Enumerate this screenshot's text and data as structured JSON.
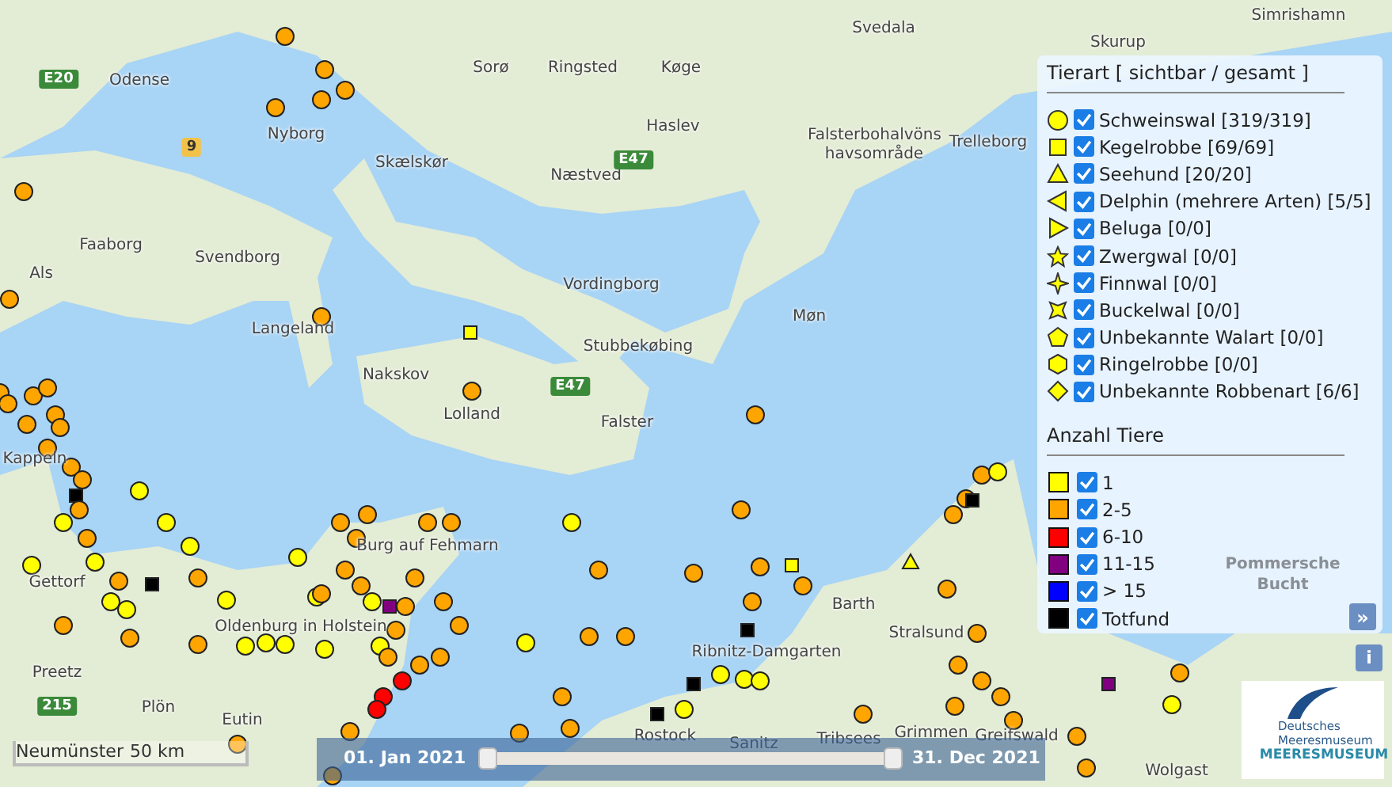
{
  "map": {
    "places": [
      "Svedala",
      "Simrishamn",
      "Odense",
      "Sorø",
      "Ringsted",
      "Køge",
      "Skurup",
      "Trelleborg",
      "Falsterbohalvöns havsområde",
      "Haslev",
      "Nyborg",
      "Skælskør",
      "Næstved",
      "Faaborg",
      "Svendborg",
      "Als",
      "Vordingborg",
      "Langeland",
      "Møn",
      "Stubbekøbing",
      "Nakskov",
      "Lolland",
      "Falster",
      "Kappeln",
      "Gettorf",
      "Burg auf Fehmarn",
      "Oldenburg in Holstein",
      "Preetz",
      "Plön",
      "Eutin",
      "Rostock",
      "Sanitz",
      "Tribsees",
      "Grimmen",
      "Greifswald",
      "Wolgast",
      "Barth",
      "Stralsund",
      "Ribnitz-Damgarten",
      "Pommersche Bucht"
    ],
    "roads": [
      "E20",
      "9",
      "E47",
      "E47",
      "215"
    ]
  },
  "legend": {
    "species_title": "Tierart [ sichtbar / gesamt ]",
    "species": [
      {
        "kind": "circle",
        "label": "Schweinswal [319/319]",
        "checked": true
      },
      {
        "kind": "square",
        "label": "Kegelrobbe [69/69]",
        "checked": true
      },
      {
        "kind": "triangle-up",
        "label": "Seehund [20/20]",
        "checked": true
      },
      {
        "kind": "triangle-left",
        "label": "Delphin (mehrere Arten) [5/5]",
        "checked": true
      },
      {
        "kind": "triangle-right",
        "label": "Beluga [0/0]",
        "checked": true
      },
      {
        "kind": "star",
        "label": "Zwergwal [0/0]",
        "checked": true
      },
      {
        "kind": "spark",
        "label": "Finnwal [0/0]",
        "checked": true
      },
      {
        "kind": "bowtie",
        "label": "Buckelwal [0/0]",
        "checked": true
      },
      {
        "kind": "pentagon",
        "label": "Unbekannte Walart [0/0]",
        "checked": true
      },
      {
        "kind": "hexagon",
        "label": "Ringelrobbe [0/0]",
        "checked": true
      },
      {
        "kind": "diamond",
        "label": "Unbekannte Robbenart [6/6]",
        "checked": true
      }
    ],
    "count_title": "Anzahl Tiere",
    "counts": [
      {
        "label": "1",
        "color": "#ffff00",
        "checked": true
      },
      {
        "label": "2-5",
        "color": "#ffa500",
        "checked": true
      },
      {
        "label": "6-10",
        "color": "#ff0000",
        "checked": true
      },
      {
        "label": "11-15",
        "color": "#800080",
        "checked": true
      },
      {
        "label": "> 15",
        "color": "#0000ff",
        "checked": true
      },
      {
        "label": "Totfund",
        "color": "#000000",
        "checked": true
      }
    ],
    "collapse_button": "»"
  },
  "info_button": "i",
  "logo": {
    "name": "Deutsches Meeresmuseum",
    "wordmark": "MEERESMUSEUM"
  },
  "scale": {
    "place": "Neumünster",
    "distance": "50 km"
  },
  "timeline": {
    "start": "01. Jan 2021",
    "end": "31. Dec 2021",
    "level": 1
  }
}
